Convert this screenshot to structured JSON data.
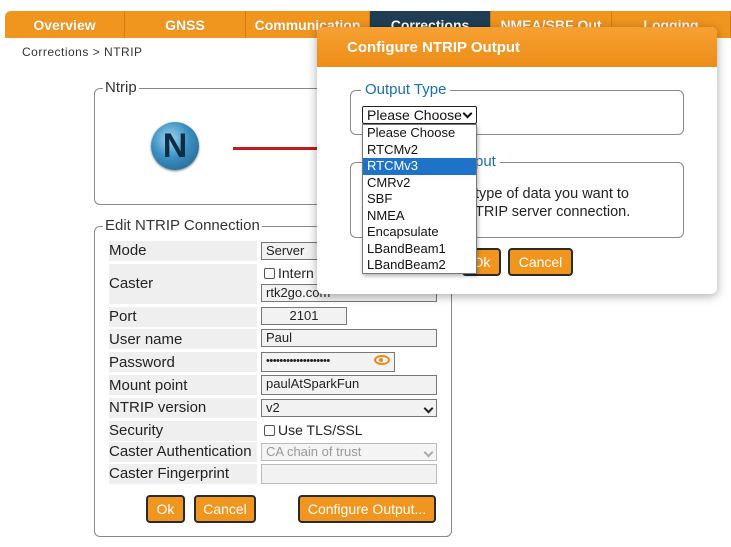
{
  "nav": {
    "tabs": [
      {
        "label": "Overview",
        "active": false
      },
      {
        "label": "GNSS",
        "active": false
      },
      {
        "label": "Communication",
        "active": false
      },
      {
        "label": "Corrections",
        "active": true
      },
      {
        "label": "NMEA/SBF Out",
        "active": false
      },
      {
        "label": "Logging",
        "active": false
      }
    ]
  },
  "breadcrumb": "Corrections > NTRIP",
  "ntrip_panel": {
    "legend": "Ntrip",
    "logo_letter": "N",
    "icon": "ntrip-logo-icon"
  },
  "edit": {
    "legend": "Edit NTRIP Connection",
    "fields": {
      "mode": {
        "label": "Mode",
        "value": "Server"
      },
      "caster": {
        "label": "Caster",
        "checkbox_label": "Intern",
        "value": "rtk2go.com"
      },
      "port": {
        "label": "Port",
        "value": "2101"
      },
      "username": {
        "label": "User name",
        "value": "Paul"
      },
      "password": {
        "label": "Password",
        "value": "•••••••••••••••••••"
      },
      "mountpoint": {
        "label": "Mount point",
        "value": "paulAtSparkFun"
      },
      "ntrip_version": {
        "label": "NTRIP version",
        "value": "v2"
      },
      "security": {
        "label": "Security",
        "checkbox_label": "Use TLS/SSL"
      },
      "caster_auth": {
        "label": "Caster Authentication",
        "value": "CA chain of trust"
      },
      "caster_fp": {
        "label": "Caster Fingerprint",
        "value": ""
      }
    },
    "buttons": {
      "ok": "Ok",
      "cancel": "Cancel",
      "configure": "Configure Output..."
    }
  },
  "modal": {
    "title": "Configure NTRIP Output",
    "output_type": {
      "legend": "Output Type",
      "selected": "Please Choose",
      "options": [
        "Please Choose",
        "RTCMv2",
        "RTCMv3",
        "CMRv2",
        "SBF",
        "NMEA",
        "Encapsulate",
        "LBandBeam1",
        "LBandBeam2"
      ],
      "highlighted_index": 2
    },
    "output_info": {
      "legend_visible": "put",
      "text_line1": "type of data you want to",
      "text_line2": "TRIP server connection."
    },
    "buttons": {
      "ok": "Ok",
      "cancel": "Cancel"
    }
  },
  "colors": {
    "accent": "#f0961f",
    "nav_active": "#1f3e55",
    "modal_legend": "#1a6fb0",
    "highlight": "#1e73c8"
  }
}
